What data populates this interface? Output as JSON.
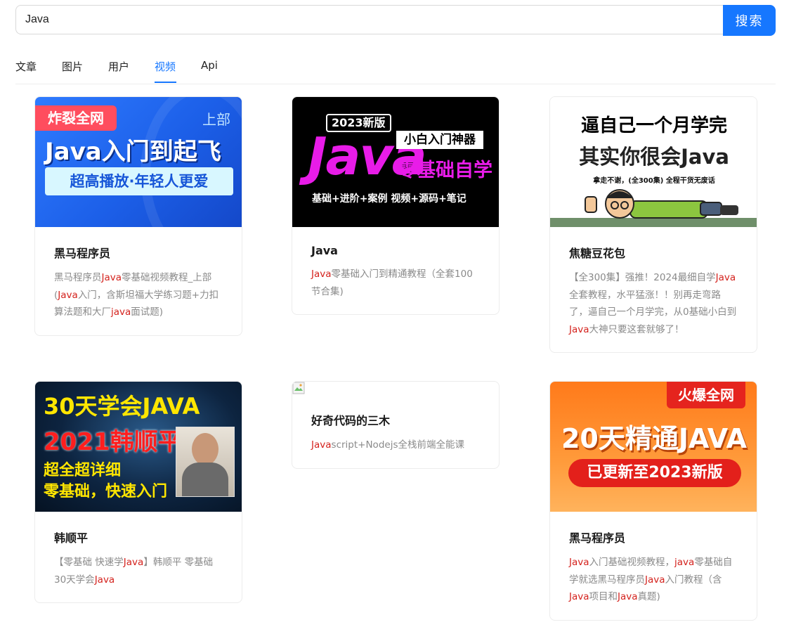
{
  "search": {
    "value": "Java",
    "button_label": "搜索"
  },
  "tabs": [
    {
      "label": "文章",
      "active": false
    },
    {
      "label": "图片",
      "active": false
    },
    {
      "label": "用户",
      "active": false
    },
    {
      "label": "视频",
      "active": true
    },
    {
      "label": "Api",
      "active": false
    }
  ],
  "highlight_color": "#d4221d",
  "accent_color": "#1677ff",
  "videos": [
    {
      "title": "黑马程序员",
      "description": [
        [
          "黑马程序员",
          false
        ],
        [
          "Java",
          true
        ],
        [
          "零基础视频教程_上部(",
          false
        ],
        [
          "Java",
          true
        ],
        [
          "入门，含斯坦福大学练习题+力扣算法题和大厂",
          false
        ],
        [
          "java",
          true
        ],
        [
          "面试题)",
          false
        ]
      ],
      "cover": {
        "badge": "炸裂全网",
        "tag": "上部",
        "headline": "Java入门到起飞",
        "subline": "超高播放·年轻人更爱"
      }
    },
    {
      "title": "Java",
      "description": [
        [
          "Java",
          true
        ],
        [
          "零基础入门到精通教程（全套100节合集)",
          false
        ]
      ],
      "cover": {
        "badge": "2023新版",
        "big": "Java",
        "tag": "小白入门神器",
        "headline": "零基础自学",
        "subline": "基础+进阶+案例 视频+源码+笔记"
      }
    },
    {
      "title": "焦糖豆花包",
      "description": [
        [
          "【全300集】强推！2024最细自学",
          false
        ],
        [
          "Java",
          true
        ],
        [
          "全套教程，水平猛涨！！别再走弯路了，逼自己一个月学完，从0基础小白到",
          false
        ],
        [
          "Java",
          true
        ],
        [
          "大神只要这套就够了！",
          false
        ]
      ],
      "cover": {
        "line1": "逼自己一个月学完",
        "line2": "其实你很会Java",
        "line3": "拿走不谢，(全300集)    全程干货无废话"
      }
    },
    {
      "title": "韩顺平",
      "description": [
        [
          "【零基础 快速学",
          false
        ],
        [
          "Java",
          true
        ],
        [
          "】韩顺平 零基础30天学会",
          false
        ],
        [
          "Java",
          true
        ]
      ],
      "cover": {
        "line1": "30天学会JAVA",
        "line2": "2021韩顺平",
        "line3": "超全超详细",
        "line4": "零基础，快速入门"
      }
    },
    {
      "title": "好奇代码的三木",
      "description": [
        [
          "Java",
          true
        ],
        [
          "script+Nodejs全栈前端全能课",
          false
        ]
      ],
      "cover": null
    },
    {
      "title": "黑马程序员",
      "description": [
        [
          "Java",
          true
        ],
        [
          "入门基础视频教程，",
          false
        ],
        [
          "java",
          true
        ],
        [
          "零基础自学就选黑马程序员",
          false
        ],
        [
          "Java",
          true
        ],
        [
          "入门教程（含",
          false
        ],
        [
          "Java",
          true
        ],
        [
          "项目和",
          false
        ],
        [
          "Java",
          true
        ],
        [
          "真题)",
          false
        ]
      ],
      "cover": {
        "badge": "火爆全网",
        "headline": "20天精通JAVA",
        "subline": "已更新至2023新版"
      }
    }
  ]
}
